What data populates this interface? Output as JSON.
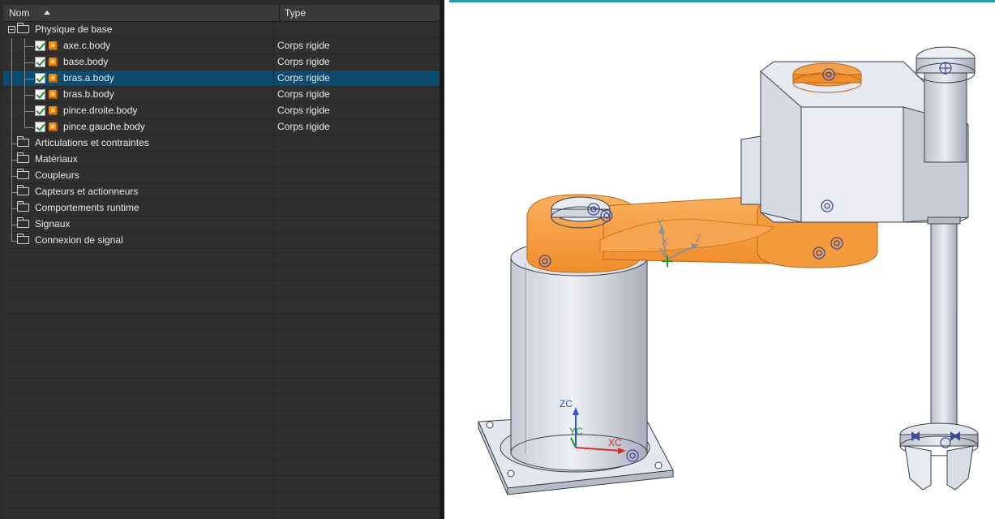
{
  "tree": {
    "columns": {
      "name": "Nom",
      "type": "Type"
    },
    "groups": [
      {
        "label": "Physique de base",
        "expanded": true
      },
      {
        "label": "Articulations et contraintes"
      },
      {
        "label": "Matériaux"
      },
      {
        "label": "Coupleurs"
      },
      {
        "label": "Capteurs et actionneurs"
      },
      {
        "label": "Comportements runtime"
      },
      {
        "label": "Signaux"
      },
      {
        "label": "Connexion de signal"
      }
    ],
    "bodies": [
      {
        "label": "axe.c.body",
        "type": "Corps rigide",
        "checked": true,
        "selected": false
      },
      {
        "label": "base.body",
        "type": "Corps rigide",
        "checked": true,
        "selected": false
      },
      {
        "label": "bras.a.body",
        "type": "Corps rigide",
        "checked": true,
        "selected": true
      },
      {
        "label": "bras.b.body",
        "type": "Corps rigide",
        "checked": true,
        "selected": false
      },
      {
        "label": "pince.droite.body",
        "type": "Corps rigide",
        "checked": true,
        "selected": false
      },
      {
        "label": "pince.gauche.body",
        "type": "Corps rigide",
        "checked": true,
        "selected": false
      }
    ],
    "selection_color": "#0c4a6e"
  },
  "viewport": {
    "triad_local": {
      "y": "Y",
      "x": "X",
      "z": "Z"
    },
    "triad_global": {
      "zc": "ZC",
      "yc": "YC",
      "xc": "XC"
    },
    "colors": {
      "highlight": "#f79a3e",
      "part": "#d6dae3",
      "edge": "#3a3f4a"
    }
  }
}
